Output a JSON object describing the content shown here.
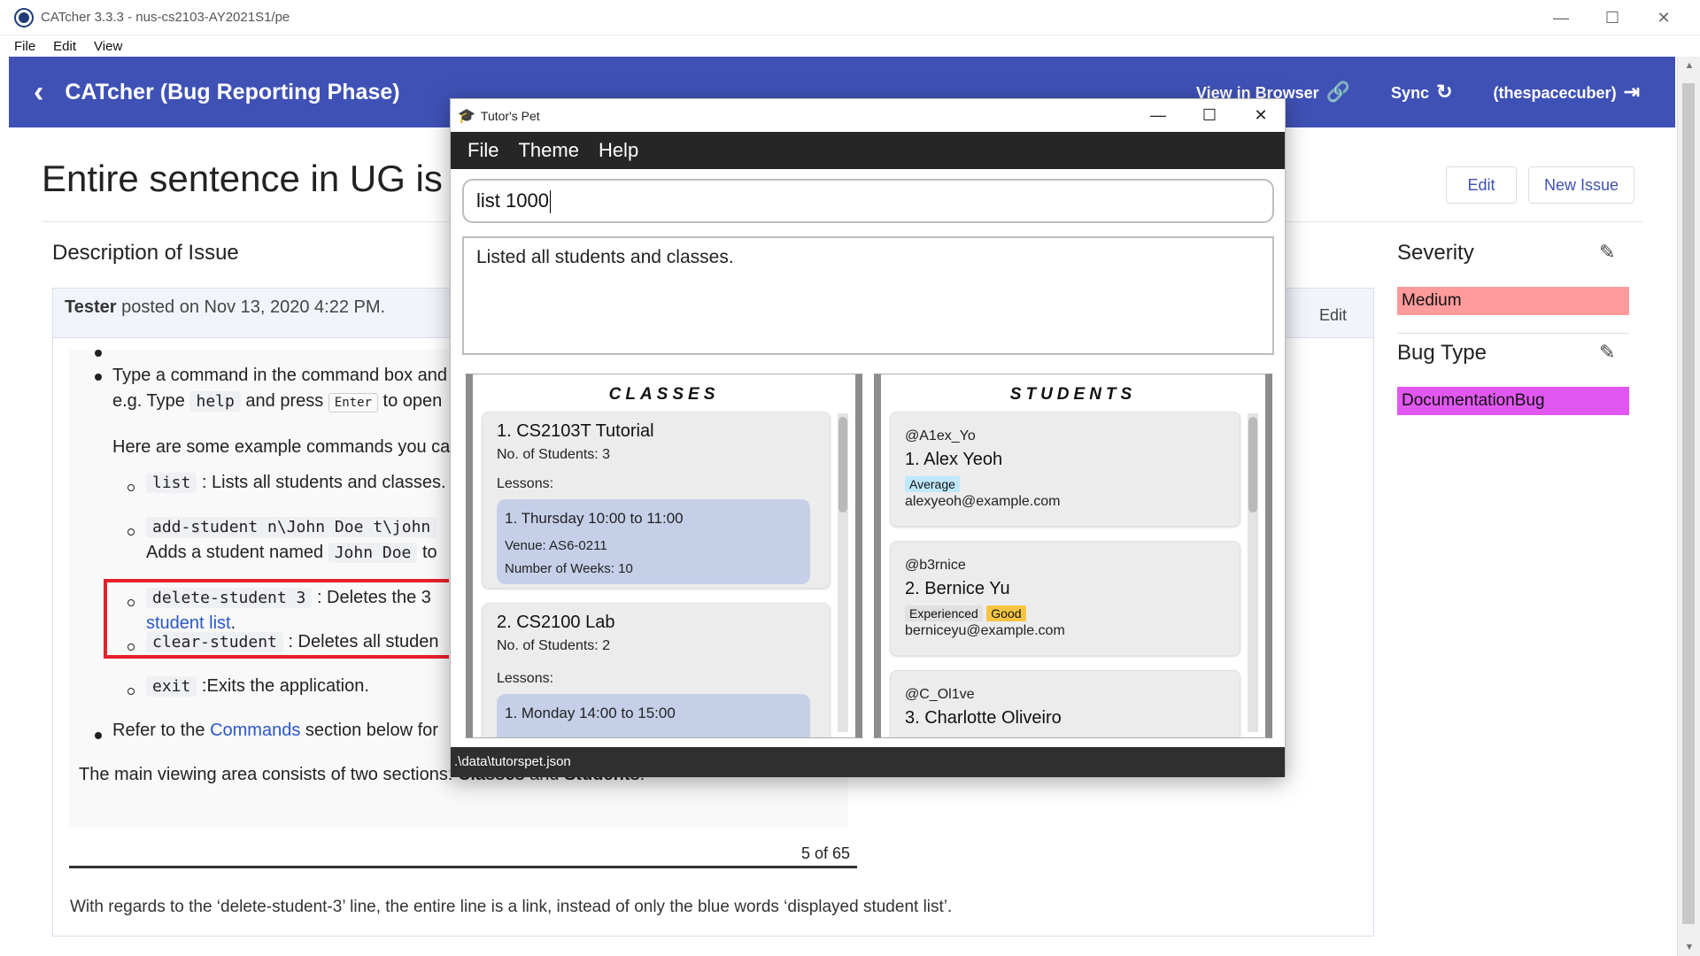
{
  "window": {
    "title": "CATcher 3.3.3 - nus-cs2103-AY2021S1/pe",
    "menus": [
      "File",
      "Edit",
      "View"
    ]
  },
  "header": {
    "title": "CATcher  (Bug Reporting Phase)",
    "view_in_browser": "View in Browser",
    "sync": "Sync",
    "user": "(thespacecuber)"
  },
  "issue": {
    "title": "Entire sentence in UG is a",
    "edit_label": "Edit",
    "new_issue_label": "New Issue",
    "description_heading": "Description of Issue",
    "post_author": "Tester",
    "post_meta": " posted on Nov 13, 2020 4:22 PM.",
    "post_edit": "Edit",
    "doc": {
      "l1a": "Type a command in the command box and",
      "l2a": "e.g. Type ",
      "l2_code": "help",
      "l2b": " and press ",
      "l2_kbd": "Enter",
      "l2c": " to open",
      "l3": "Here are some example commands you ca",
      "c1_code": "list",
      "c1_text": " : Lists all students and classes.",
      "c2_code": "add-student n\\John Doe t\\john",
      "c2_l2a": "Adds a student named ",
      "c2_code2": "John Doe",
      "c2_l2b": " to",
      "c3_code": "delete-student 3",
      "c3_text": " : Deletes the 3",
      "c3_link": "student list",
      "c3_after": ".",
      "c4_code": "clear-student",
      "c4_text": " : Deletes all studen",
      "c5_code": "exit",
      "c5_text": " :Exits the application.",
      "r1a": "Refer to the ",
      "r1_link": "Commands",
      "r1b": " section below for",
      "main_a": "The main viewing area consists of two sections: ",
      "main_b1": "Classes",
      "main_and": " and ",
      "main_b2": "Students",
      "main_end": ".",
      "page": "5 of 65"
    },
    "comment": "With regards to the ‘delete-student-3’ line, the entire line is a link, instead of only the blue words ‘displayed student list’."
  },
  "sidebar": {
    "severity_heading": "Severity",
    "severity_value": "Medium",
    "severity_color": "#ff9b9b",
    "bugtype_heading": "Bug Type",
    "bugtype_value": "DocumentationBug",
    "bugtype_color": "#e257f2"
  },
  "tutorspet": {
    "title": "Tutor's Pet",
    "menus": [
      "File",
      "Theme",
      "Help"
    ],
    "command": "list 1000",
    "result": "Listed all students and classes.",
    "classes_header": "CLASSES",
    "students_header": "STUDENTS",
    "classes": [
      {
        "title": "1.  CS2103T Tutorial",
        "students": "No. of Students:  3",
        "lessons_label": "Lessons:",
        "lesson": "1. Thursday 10:00 to 11:00",
        "venue": "Venue: AS6-0211",
        "weeks": "Number of Weeks: 10"
      },
      {
        "title": "2.  CS2100 Lab",
        "students": "No. of Students:  2",
        "lessons_label": "Lessons:",
        "lesson": "1. Monday 14:00 to 15:00"
      }
    ],
    "students": [
      {
        "handle": "@A1ex_Yo",
        "name": "1.  Alex Yeoh",
        "tags": [
          "Average"
        ],
        "email": "alexyeoh@example.com"
      },
      {
        "handle": "@b3rnice",
        "name": "2.  Bernice Yu",
        "tags": [
          "Experienced",
          "Good"
        ],
        "email": "berniceyu@example.com"
      },
      {
        "handle": "@C_Ol1ve",
        "name": "3.  Charlotte Oliveiro"
      }
    ],
    "status": ".\\data\\tutorspet.json"
  }
}
